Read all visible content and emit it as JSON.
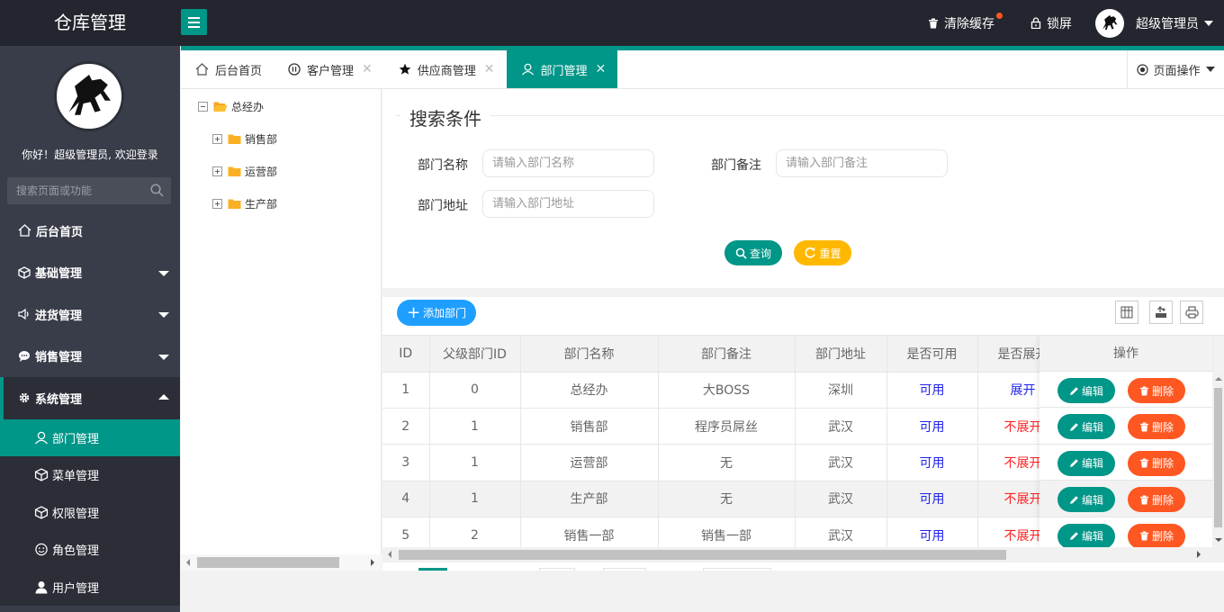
{
  "app": {
    "title": "仓库管理"
  },
  "header": {
    "clear_cache": "清除缓存",
    "lock_screen": "锁屏",
    "user_name": "超级管理员"
  },
  "sidebar": {
    "welcome": "你好！超级管理员, 欢迎登录",
    "search_placeholder": "搜索页面或功能",
    "items": [
      {
        "label": "后台首页",
        "icon": "home-icon"
      },
      {
        "label": "基础管理",
        "icon": "cube-icon"
      },
      {
        "label": "进货管理",
        "icon": "speaker-icon"
      },
      {
        "label": "销售管理",
        "icon": "chat-icon"
      },
      {
        "label": "系统管理",
        "icon": "gear-icon"
      }
    ],
    "sub_items": [
      {
        "label": "部门管理",
        "icon": "user-icon"
      },
      {
        "label": "菜单管理",
        "icon": "cube-icon"
      },
      {
        "label": "权限管理",
        "icon": "cube-icon"
      },
      {
        "label": "角色管理",
        "icon": "smile-icon"
      },
      {
        "label": "用户管理",
        "icon": "person-icon"
      }
    ]
  },
  "tabs": [
    {
      "label": "后台首页"
    },
    {
      "label": "客户管理"
    },
    {
      "label": "供应商管理"
    },
    {
      "label": "部门管理"
    }
  ],
  "page_ops": "页面操作",
  "tree": {
    "root": "总经办",
    "children": [
      "销售部",
      "运营部",
      "生产部"
    ]
  },
  "search": {
    "legend": "搜索条件",
    "name_label": "部门名称",
    "name_placeholder": "请输入部门名称",
    "remark_label": "部门备注",
    "remark_placeholder": "请输入部门备注",
    "address_label": "部门地址",
    "address_placeholder": "请输入部门地址",
    "query_btn": "查询",
    "reset_btn": "重置"
  },
  "toolbar": {
    "add_btn": "添加部门"
  },
  "table": {
    "headers": [
      "ID",
      "父级部门ID",
      "部门名称",
      "部门备注",
      "部门地址",
      "是否可用",
      "是否展开"
    ],
    "ops_header": "操作",
    "edit_label": "编辑",
    "delete_label": "删除",
    "rows": [
      {
        "id": "1",
        "pid": "0",
        "name": "总经办",
        "remark": "大BOSS",
        "address": "深圳",
        "available": "可用",
        "open": "展开"
      },
      {
        "id": "2",
        "pid": "1",
        "name": "销售部",
        "remark": "程序员屌丝",
        "address": "武汉",
        "available": "可用",
        "open": "不展开"
      },
      {
        "id": "3",
        "pid": "1",
        "name": "运营部",
        "remark": "无",
        "address": "武汉",
        "available": "可用",
        "open": "不展开"
      },
      {
        "id": "4",
        "pid": "1",
        "name": "生产部",
        "remark": "无",
        "address": "武汉",
        "available": "可用",
        "open": "不展开"
      },
      {
        "id": "5",
        "pid": "2",
        "name": "销售一部",
        "remark": "销售一部",
        "address": "武汉",
        "available": "可用",
        "open": "不展开"
      }
    ]
  },
  "colors": {
    "primary": "#009688",
    "header_bg": "#23262e",
    "sidebar_bg": "#393d49",
    "blue_btn": "#1e9fff",
    "warm_btn": "#ffb800",
    "danger_btn": "#ff5722"
  }
}
